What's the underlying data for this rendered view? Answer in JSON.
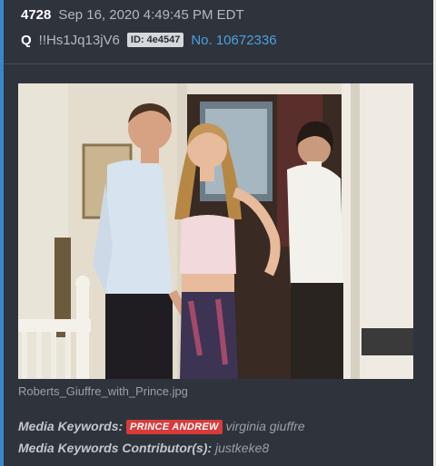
{
  "post": {
    "number": "4728",
    "date": "Sep 16, 2020 4:49:45 PM EDT",
    "author": "Q",
    "tripcode": "!!Hs1Jq13jV6",
    "id_badge": "ID: 4e4547",
    "post_link": "No. 10672336"
  },
  "media": {
    "icon": "photo-image",
    "filename": "Roberts_Giuffre_with_Prince.jpg"
  },
  "keywords": {
    "label": "Media Keywords:",
    "tag": "PRINCE ANDREW",
    "value": "virginia giuffre",
    "contributor_label": "Media Keywords Contributor(s):",
    "contributor": "justkeke8"
  },
  "colors": {
    "background": "#2f333c",
    "accent": "#3a86c8",
    "link": "#4aa1e0",
    "tag": "#d83b3b"
  }
}
